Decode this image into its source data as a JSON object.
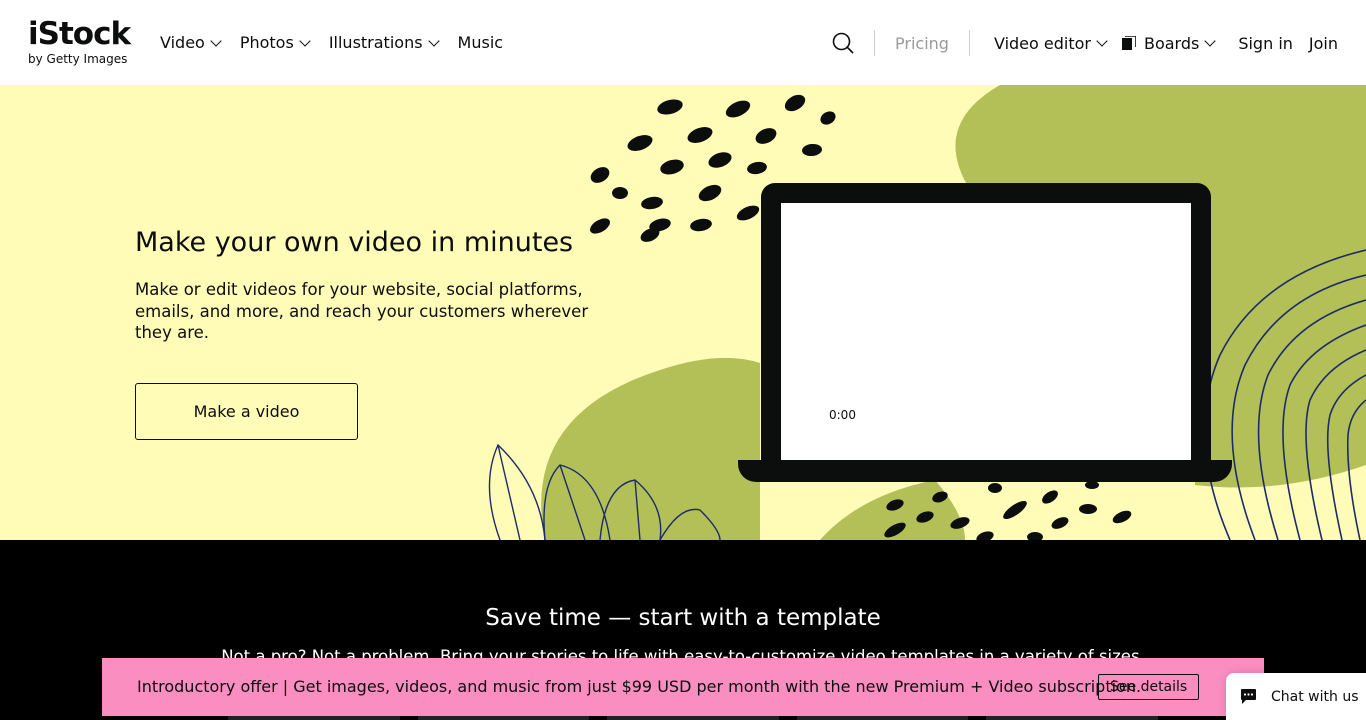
{
  "brand": {
    "name": "iStock",
    "tagline": "by Getty Images"
  },
  "nav": {
    "left": [
      {
        "label": "Video",
        "has_dropdown": true
      },
      {
        "label": "Photos",
        "has_dropdown": true
      },
      {
        "label": "Illustrations",
        "has_dropdown": true
      },
      {
        "label": "Music",
        "has_dropdown": false
      }
    ],
    "pricing": "Pricing",
    "video_editor": "Video editor",
    "boards": "Boards",
    "sign_in": "Sign in",
    "join": "Join"
  },
  "hero": {
    "title": "Make your own video in minutes",
    "description": "Make or edit videos for your website, social platforms, emails, and more, and reach your customers wherever they are.",
    "cta": "Make a video",
    "video_time": "0:00",
    "colors": {
      "background": "#fffcb8",
      "accent": "#b3bf57",
      "line_art": "#1c2b6b"
    }
  },
  "templates": {
    "title": "Save time — start with a template",
    "subtitle": "Not a pro? Not a problem. Bring your stories to life with easy-to-customize video templates in a variety of sizes."
  },
  "promo": {
    "text": "Introductory offer | Get images, videos, and music from just $99 USD per month with the new Premium + Video subscription.",
    "button": "See details",
    "color": "#fb8ec1"
  },
  "chat": {
    "label": "Chat with us"
  }
}
